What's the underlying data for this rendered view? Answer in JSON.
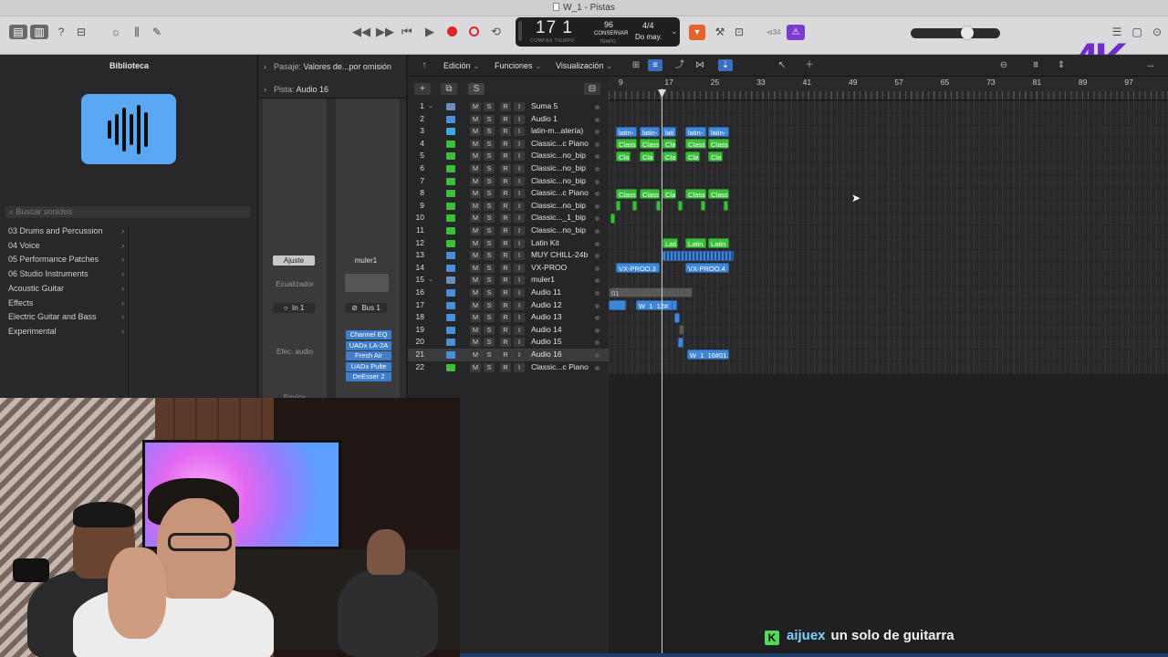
{
  "window": {
    "title": "W_1 - Pistas"
  },
  "toolbar": {
    "transport": {
      "rewind": "◀◀",
      "forward": "▶▶",
      "to_start": "⏮",
      "play": "▶",
      "cycle": "⟲"
    },
    "lcd": {
      "bars": "17 1",
      "bars_label": "COMPÁS TIEMPO",
      "tempo": "96",
      "tempo_mode": "CONSERVAR",
      "tempo_label": "TEMPO",
      "signature": "4/4",
      "key": "Do may."
    },
    "count_in": "⊲34",
    "master_volume_fraction": 0.65
  },
  "library": {
    "title": "Biblioteca",
    "search_placeholder": "Buscar sonidos",
    "items": [
      {
        "label": "03 Drums and Percussion"
      },
      {
        "label": "04 Voice"
      },
      {
        "label": "05 Performance Patches"
      },
      {
        "label": "06 Studio Instruments"
      },
      {
        "label": "Acoustic Guitar"
      },
      {
        "label": "Effects"
      },
      {
        "label": "Electric Guitar and Bass"
      },
      {
        "label": "Experimental"
      }
    ]
  },
  "inspector": {
    "region_label": "Pasaje:",
    "region_value": "Valores de...por omisión",
    "track_label": "Pista:",
    "track_value": "Audio 16",
    "strip1": {
      "setting": "Ajuste",
      "eq": "Ecualizador",
      "input": "In 1",
      "fx": "Efec. audio",
      "sends": "Envíos"
    },
    "strip2": {
      "setting": "muler1",
      "output": "Bus 1"
    },
    "plugins": [
      "Channel EQ",
      "UADx LA-2A",
      "Fresh Air",
      "UADx Pulte",
      "DeEsser 2"
    ]
  },
  "tracks_header": {
    "menus": [
      {
        "label": "Edición"
      },
      {
        "label": "Funciones"
      },
      {
        "label": "Visualización"
      }
    ]
  },
  "track_toolbar": {
    "add": "+",
    "dup": "⧉",
    "solo": "S"
  },
  "ruler": {
    "bars": [
      "9",
      "17",
      "25",
      "33",
      "41",
      "49",
      "57",
      "65",
      "73",
      "81",
      "89",
      "97"
    ]
  },
  "tracks": [
    {
      "num": "1",
      "name": "Suma 5",
      "folder": true,
      "icon": "folder-icon"
    },
    {
      "num": "2",
      "name": "Audio 1",
      "icon": "audio-icon"
    },
    {
      "num": "3",
      "name": "latin-m...atería)",
      "icon": "drummer-icon"
    },
    {
      "num": "4",
      "name": "Classic...c Piano",
      "icon": "midi-icon"
    },
    {
      "num": "5",
      "name": "Classic...no_bip",
      "icon": "midi-icon"
    },
    {
      "num": "6",
      "name": "Classic...no_bip",
      "icon": "midi-icon"
    },
    {
      "num": "7",
      "name": "Classic...no_bip",
      "icon": "midi-icon"
    },
    {
      "num": "8",
      "name": "Classic...c Piano",
      "icon": "midi-icon"
    },
    {
      "num": "9",
      "name": "Classic...no_bip",
      "icon": "midi-icon"
    },
    {
      "num": "10",
      "name": "Classic..._1_bip",
      "icon": "midi-icon"
    },
    {
      "num": "11",
      "name": "Classic...no_bip",
      "icon": "midi-icon"
    },
    {
      "num": "12",
      "name": "Latin Kit",
      "icon": "drum-kit-icon"
    },
    {
      "num": "13",
      "name": "MUY CHILL-24b",
      "icon": "audio-icon"
    },
    {
      "num": "14",
      "name": "VX-PROO",
      "icon": "audio-icon"
    },
    {
      "num": "15",
      "name": "muler1",
      "folder": true,
      "icon": "folder-icon"
    },
    {
      "num": "16",
      "name": "Audio 11",
      "icon": "audio-icon"
    },
    {
      "num": "17",
      "name": "Audio 12",
      "icon": "audio-icon"
    },
    {
      "num": "18",
      "name": "Audio 13",
      "icon": "audio-icon"
    },
    {
      "num": "19",
      "name": "Audio 14",
      "icon": "audio-icon"
    },
    {
      "num": "20",
      "name": "Audio 15",
      "icon": "audio-icon"
    },
    {
      "num": "21",
      "name": "Audio 16",
      "icon": "audio-icon",
      "selected": true
    },
    {
      "num": "22",
      "name": "Classic...c Piano",
      "icon": "midi-icon"
    }
  ],
  "regions": [
    {
      "track": 3,
      "label": "latin-",
      "color": "blue"
    },
    {
      "track": 3,
      "label": "latin-",
      "color": "blue"
    },
    {
      "track": 3,
      "label": "lati",
      "color": "blue"
    },
    {
      "track": 3,
      "label": "latin-",
      "color": "blue"
    },
    {
      "track": 3,
      "label": "latin-",
      "color": "blue"
    },
    {
      "track": 4,
      "label": "Class",
      "color": "green"
    },
    {
      "track": 4,
      "label": "Class",
      "color": "green"
    },
    {
      "track": 4,
      "label": "Cla",
      "color": "green"
    },
    {
      "track": 4,
      "label": "Class",
      "color": "green"
    },
    {
      "track": 4,
      "label": "Class",
      "color": "green"
    },
    {
      "track": 5,
      "label": "Cla",
      "color": "green"
    },
    {
      "track": 5,
      "label": "Cla",
      "color": "green"
    },
    {
      "track": 5,
      "label": "Cla",
      "color": "green"
    },
    {
      "track": 5,
      "label": "Cla",
      "color": "green"
    },
    {
      "track": 5,
      "label": "Cla",
      "color": "green"
    },
    {
      "track": 8,
      "label": "Class",
      "color": "green"
    },
    {
      "track": 8,
      "label": "Class",
      "color": "green"
    },
    {
      "track": 8,
      "label": "Cla",
      "color": "green"
    },
    {
      "track": 8,
      "label": "Class",
      "color": "green"
    },
    {
      "track": 8,
      "label": "Class",
      "color": "green"
    },
    {
      "track": 12,
      "label": "Lati",
      "color": "green"
    },
    {
      "track": 12,
      "label": "Latin",
      "color": "green"
    },
    {
      "track": 12,
      "label": "Latin",
      "color": "green"
    },
    {
      "track": 13,
      "label": "",
      "color": "blue"
    },
    {
      "track": 14,
      "label": "VX-PROO.3",
      "color": "blue"
    },
    {
      "track": 14,
      "label": "VX-PROO.4",
      "color": "blue"
    },
    {
      "track": 16,
      "label": "01",
      "color": "gray"
    },
    {
      "track": 17,
      "label": "",
      "color": "blue"
    },
    {
      "track": 17,
      "label": "W_1_12#",
      "color": "blue"
    },
    {
      "track": 21,
      "label": "W_1_16#01.",
      "color": "blue"
    }
  ],
  "caption": {
    "badge": "K",
    "user": "aijuex",
    "text": "un solo de guitarra"
  },
  "logo": {
    "text": "4K"
  }
}
